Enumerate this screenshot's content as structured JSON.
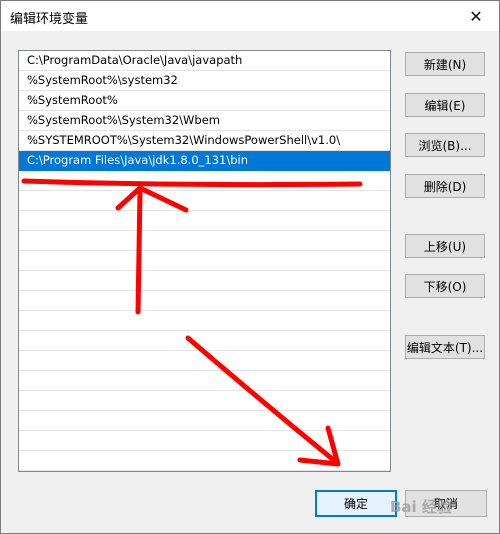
{
  "window": {
    "title": "编辑环境变量"
  },
  "icons": {
    "close": "close-icon"
  },
  "paths": [
    "C:\\ProgramData\\Oracle\\Java\\javapath",
    "%SystemRoot%\\system32",
    "%SystemRoot%",
    "%SystemRoot%\\System32\\Wbem",
    "%SYSTEMROOT%\\System32\\WindowsPowerShell\\v1.0\\",
    "C:\\Program Files\\Java\\jdk1.8.0_131\\bin"
  ],
  "selected_index": 5,
  "buttons": {
    "new": "新建(N)",
    "edit": "编辑(E)",
    "browse": "浏览(B)...",
    "delete": "删除(D)",
    "move_up": "上移(U)",
    "move_down": "下移(O)",
    "edit_text": "编辑文本(T)...",
    "ok": "确定",
    "cancel": "取消"
  },
  "watermark": "Bai 经验",
  "colors": {
    "selection": "#0078d7",
    "annotation": "#ff0000"
  }
}
